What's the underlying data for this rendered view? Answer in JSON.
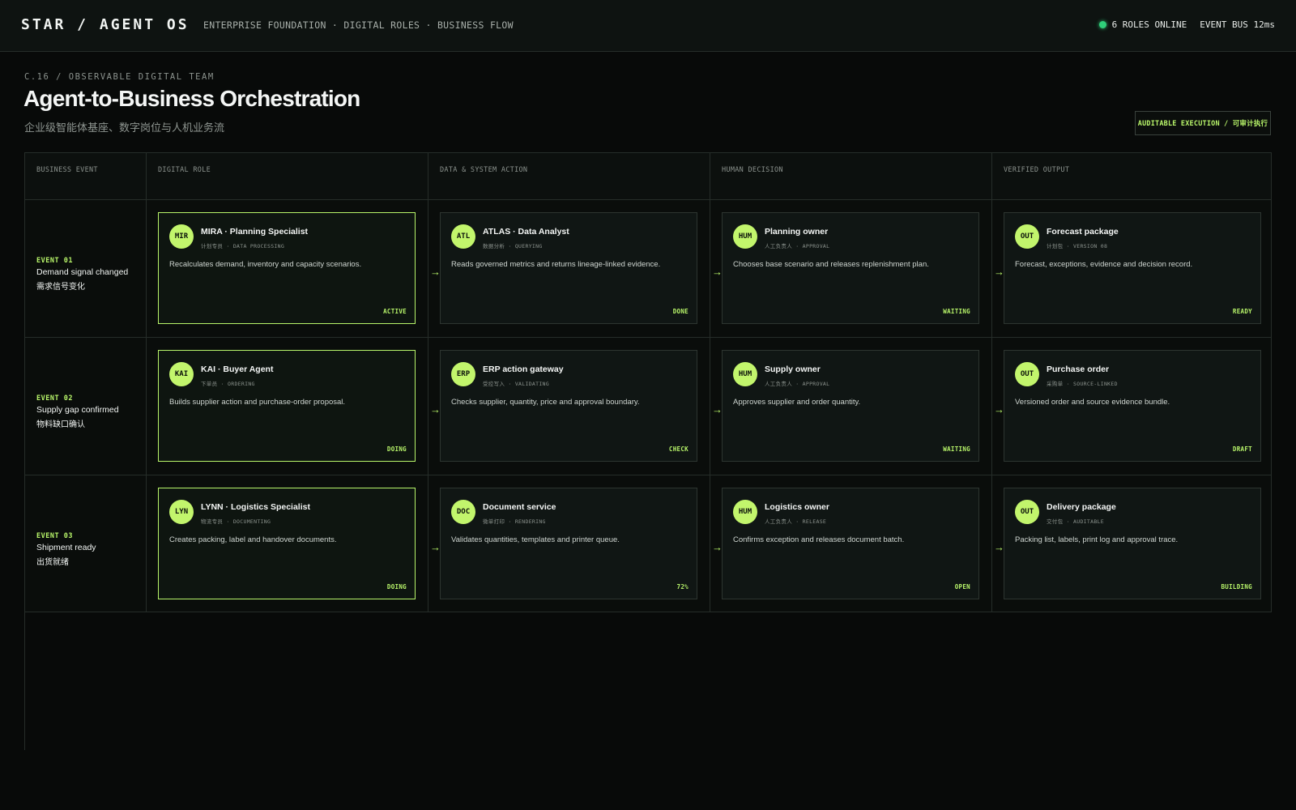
{
  "topbar": {
    "brand": "STAR / AGENT OS",
    "nav": "ENTERPRISE FOUNDATION · DIGITAL ROLES · BUSINESS FLOW",
    "roles_online": "6 ROLES ONLINE",
    "event_bus": "EVENT BUS 12ms",
    "status_color": "#2fcf7a"
  },
  "page": {
    "kicker": "C.16 / OBSERVABLE DIGITAL TEAM",
    "title": "Agent-to-Business Orchestration",
    "subtitle": "企业级智能体基座、数字岗位与人机业务流",
    "badge": "AUDITABLE EXECUTION / 可审计执行"
  },
  "theme": {
    "accent": "#b8f56a",
    "background": "#080a09"
  },
  "columns": [
    "BUSINESS EVENT",
    "DIGITAL ROLE",
    "DATA & SYSTEM ACTION",
    "HUMAN DECISION",
    "VERIFIED OUTPUT"
  ],
  "arrow_icon": "→",
  "rows": [
    {
      "event": {
        "id": "EVENT 01",
        "en": "Demand signal changed",
        "zh": "需求信号变化"
      },
      "cards": [
        {
          "avatar": "MIR",
          "title": "MIRA · Planning Specialist",
          "meta_zh": "计划专员",
          "meta_en": "DATA PROCESSING",
          "desc": "Recalculates demand, inventory and capacity scenarios.",
          "status": "ACTIVE",
          "active": true
        },
        {
          "avatar": "ATL",
          "title": "ATLAS · Data Analyst",
          "meta_zh": "数据分析",
          "meta_en": "QUERYING",
          "desc": "Reads governed metrics and returns lineage-linked evidence.",
          "status": "DONE",
          "active": false
        },
        {
          "avatar": "HUM",
          "title": "Planning owner",
          "meta_zh": "人工负责人",
          "meta_en": "APPROVAL",
          "desc": "Chooses base scenario and releases replenishment plan.",
          "status": "WAITING",
          "active": false
        },
        {
          "avatar": "OUT",
          "title": "Forecast package",
          "meta_zh": "计划包",
          "meta_en": "VERSION 08",
          "desc": "Forecast, exceptions, evidence and decision record.",
          "status": "READY",
          "active": false
        }
      ]
    },
    {
      "event": {
        "id": "EVENT 02",
        "en": "Supply gap confirmed",
        "zh": "物料缺口确认"
      },
      "cards": [
        {
          "avatar": "KAI",
          "title": "KAI · Buyer Agent",
          "meta_zh": "下单员",
          "meta_en": "ORDERING",
          "desc": "Builds supplier action and purchase-order proposal.",
          "status": "DOING",
          "active": true
        },
        {
          "avatar": "ERP",
          "title": "ERP action gateway",
          "meta_zh": "受控写入",
          "meta_en": "VALIDATING",
          "desc": "Checks supplier, quantity, price and approval boundary.",
          "status": "CHECK",
          "active": false
        },
        {
          "avatar": "HUM",
          "title": "Supply owner",
          "meta_zh": "人工负责人",
          "meta_en": "APPROVAL",
          "desc": "Approves supplier and order quantity.",
          "status": "WAITING",
          "active": false
        },
        {
          "avatar": "OUT",
          "title": "Purchase order",
          "meta_zh": "采购单",
          "meta_en": "SOURCE-LINKED",
          "desc": "Versioned order and source evidence bundle.",
          "status": "DRAFT",
          "active": false
        }
      ]
    },
    {
      "event": {
        "id": "EVENT 03",
        "en": "Shipment ready",
        "zh": "出货就绪"
      },
      "cards": [
        {
          "avatar": "LYN",
          "title": "LYNN · Logistics Specialist",
          "meta_zh": "物流专员",
          "meta_en": "DOCUMENTING",
          "desc": "Creates packing, label and handover documents.",
          "status": "DOING",
          "active": true
        },
        {
          "avatar": "DOC",
          "title": "Document service",
          "meta_zh": "微单打印",
          "meta_en": "RENDERING",
          "desc": "Validates quantities, templates and printer queue.",
          "status": "72%",
          "active": false
        },
        {
          "avatar": "HUM",
          "title": "Logistics owner",
          "meta_zh": "人工负责人",
          "meta_en": "RELEASE",
          "desc": "Confirms exception and releases document batch.",
          "status": "OPEN",
          "active": false
        },
        {
          "avatar": "OUT",
          "title": "Delivery package",
          "meta_zh": "交付包",
          "meta_en": "AUDITABLE",
          "desc": "Packing list, labels, print log and approval trace.",
          "status": "BUILDING",
          "active": false
        }
      ]
    }
  ]
}
